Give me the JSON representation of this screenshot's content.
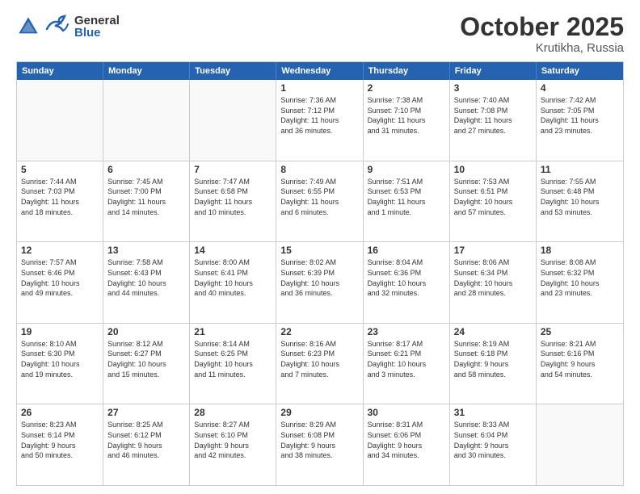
{
  "logo": {
    "general": "General",
    "blue": "Blue"
  },
  "title": "October 2025",
  "location": "Krutikha, Russia",
  "days_of_week": [
    "Sunday",
    "Monday",
    "Tuesday",
    "Wednesday",
    "Thursday",
    "Friday",
    "Saturday"
  ],
  "rows": [
    [
      {
        "day": "",
        "text": "",
        "empty": true
      },
      {
        "day": "",
        "text": "",
        "empty": true
      },
      {
        "day": "",
        "text": "",
        "empty": true
      },
      {
        "day": "1",
        "text": "Sunrise: 7:36 AM\nSunset: 7:12 PM\nDaylight: 11 hours\nand 36 minutes.",
        "empty": false
      },
      {
        "day": "2",
        "text": "Sunrise: 7:38 AM\nSunset: 7:10 PM\nDaylight: 11 hours\nand 31 minutes.",
        "empty": false
      },
      {
        "day": "3",
        "text": "Sunrise: 7:40 AM\nSunset: 7:08 PM\nDaylight: 11 hours\nand 27 minutes.",
        "empty": false
      },
      {
        "day": "4",
        "text": "Sunrise: 7:42 AM\nSunset: 7:05 PM\nDaylight: 11 hours\nand 23 minutes.",
        "empty": false
      }
    ],
    [
      {
        "day": "5",
        "text": "Sunrise: 7:44 AM\nSunset: 7:03 PM\nDaylight: 11 hours\nand 18 minutes.",
        "empty": false
      },
      {
        "day": "6",
        "text": "Sunrise: 7:45 AM\nSunset: 7:00 PM\nDaylight: 11 hours\nand 14 minutes.",
        "empty": false
      },
      {
        "day": "7",
        "text": "Sunrise: 7:47 AM\nSunset: 6:58 PM\nDaylight: 11 hours\nand 10 minutes.",
        "empty": false
      },
      {
        "day": "8",
        "text": "Sunrise: 7:49 AM\nSunset: 6:55 PM\nDaylight: 11 hours\nand 6 minutes.",
        "empty": false
      },
      {
        "day": "9",
        "text": "Sunrise: 7:51 AM\nSunset: 6:53 PM\nDaylight: 11 hours\nand 1 minute.",
        "empty": false
      },
      {
        "day": "10",
        "text": "Sunrise: 7:53 AM\nSunset: 6:51 PM\nDaylight: 10 hours\nand 57 minutes.",
        "empty": false
      },
      {
        "day": "11",
        "text": "Sunrise: 7:55 AM\nSunset: 6:48 PM\nDaylight: 10 hours\nand 53 minutes.",
        "empty": false
      }
    ],
    [
      {
        "day": "12",
        "text": "Sunrise: 7:57 AM\nSunset: 6:46 PM\nDaylight: 10 hours\nand 49 minutes.",
        "empty": false
      },
      {
        "day": "13",
        "text": "Sunrise: 7:58 AM\nSunset: 6:43 PM\nDaylight: 10 hours\nand 44 minutes.",
        "empty": false
      },
      {
        "day": "14",
        "text": "Sunrise: 8:00 AM\nSunset: 6:41 PM\nDaylight: 10 hours\nand 40 minutes.",
        "empty": false
      },
      {
        "day": "15",
        "text": "Sunrise: 8:02 AM\nSunset: 6:39 PM\nDaylight: 10 hours\nand 36 minutes.",
        "empty": false
      },
      {
        "day": "16",
        "text": "Sunrise: 8:04 AM\nSunset: 6:36 PM\nDaylight: 10 hours\nand 32 minutes.",
        "empty": false
      },
      {
        "day": "17",
        "text": "Sunrise: 8:06 AM\nSunset: 6:34 PM\nDaylight: 10 hours\nand 28 minutes.",
        "empty": false
      },
      {
        "day": "18",
        "text": "Sunrise: 8:08 AM\nSunset: 6:32 PM\nDaylight: 10 hours\nand 23 minutes.",
        "empty": false
      }
    ],
    [
      {
        "day": "19",
        "text": "Sunrise: 8:10 AM\nSunset: 6:30 PM\nDaylight: 10 hours\nand 19 minutes.",
        "empty": false
      },
      {
        "day": "20",
        "text": "Sunrise: 8:12 AM\nSunset: 6:27 PM\nDaylight: 10 hours\nand 15 minutes.",
        "empty": false
      },
      {
        "day": "21",
        "text": "Sunrise: 8:14 AM\nSunset: 6:25 PM\nDaylight: 10 hours\nand 11 minutes.",
        "empty": false
      },
      {
        "day": "22",
        "text": "Sunrise: 8:16 AM\nSunset: 6:23 PM\nDaylight: 10 hours\nand 7 minutes.",
        "empty": false
      },
      {
        "day": "23",
        "text": "Sunrise: 8:17 AM\nSunset: 6:21 PM\nDaylight: 10 hours\nand 3 minutes.",
        "empty": false
      },
      {
        "day": "24",
        "text": "Sunrise: 8:19 AM\nSunset: 6:18 PM\nDaylight: 9 hours\nand 58 minutes.",
        "empty": false
      },
      {
        "day": "25",
        "text": "Sunrise: 8:21 AM\nSunset: 6:16 PM\nDaylight: 9 hours\nand 54 minutes.",
        "empty": false
      }
    ],
    [
      {
        "day": "26",
        "text": "Sunrise: 8:23 AM\nSunset: 6:14 PM\nDaylight: 9 hours\nand 50 minutes.",
        "empty": false
      },
      {
        "day": "27",
        "text": "Sunrise: 8:25 AM\nSunset: 6:12 PM\nDaylight: 9 hours\nand 46 minutes.",
        "empty": false
      },
      {
        "day": "28",
        "text": "Sunrise: 8:27 AM\nSunset: 6:10 PM\nDaylight: 9 hours\nand 42 minutes.",
        "empty": false
      },
      {
        "day": "29",
        "text": "Sunrise: 8:29 AM\nSunset: 6:08 PM\nDaylight: 9 hours\nand 38 minutes.",
        "empty": false
      },
      {
        "day": "30",
        "text": "Sunrise: 8:31 AM\nSunset: 6:06 PM\nDaylight: 9 hours\nand 34 minutes.",
        "empty": false
      },
      {
        "day": "31",
        "text": "Sunrise: 8:33 AM\nSunset: 6:04 PM\nDaylight: 9 hours\nand 30 minutes.",
        "empty": false
      },
      {
        "day": "",
        "text": "",
        "empty": true
      }
    ]
  ]
}
